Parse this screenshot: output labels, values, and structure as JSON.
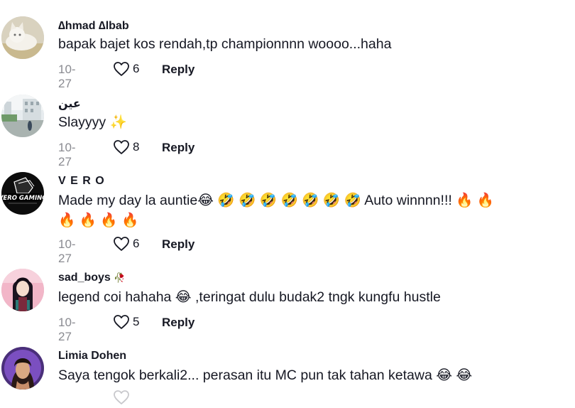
{
  "comments": [
    {
      "username": "∆hmad ∆lbab",
      "badge": "",
      "text": "bapak bajet kos rendah,tp championnnn woooo...haha",
      "text2": "",
      "date": "10-27",
      "likes": "6",
      "reply": "Reply",
      "avatar": "white-cat-avatar"
    },
    {
      "username": "عين",
      "badge": "",
      "text": "Slayyyy ✨",
      "text2": "",
      "date": "10-27",
      "likes": "8",
      "reply": "Reply",
      "avatar": "street-photo-avatar"
    },
    {
      "username": "V E R O",
      "badge": "",
      "text": "Made my day la auntie😂 🤣 🤣 🤣 🤣 🤣 🤣 🤣  Auto winnnn!!! 🔥 🔥",
      "text2": "🔥 🔥 🔥 🔥",
      "date": "10-27",
      "likes": "6",
      "reply": "Reply",
      "avatar": "vero-gaming-logo-avatar"
    },
    {
      "username": "sad_boys",
      "badge": "🥀",
      "text": "legend coi hahaha 😂 ,teringat dulu budak2 tngk kungfu hustle",
      "text2": "",
      "date": "10-27",
      "likes": "5",
      "reply": "Reply",
      "avatar": "anime-character-avatar"
    },
    {
      "username": "Limia Dohen",
      "badge": "",
      "text": "Saya tengok berkali2... perasan itu MC pun tak tahan ketawa 😂 😂",
      "text2": "",
      "date": "",
      "likes": "",
      "reply": "",
      "avatar": "portrait-avatar"
    }
  ]
}
